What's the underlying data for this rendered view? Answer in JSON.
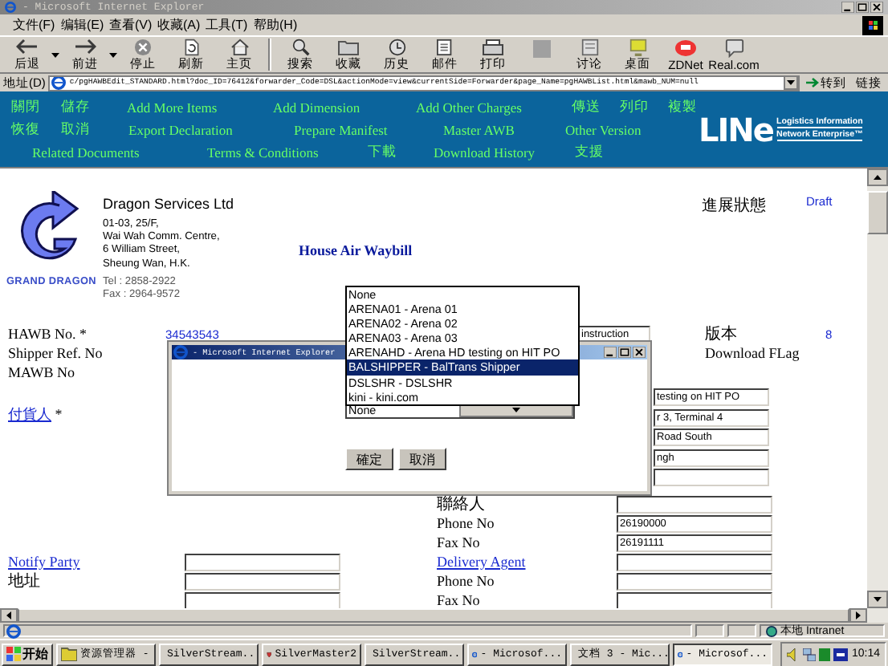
{
  "window": {
    "title": "- Microsoft Internet Explorer"
  },
  "menu": [
    "文件(F)",
    "编辑(E)",
    "查看(V)",
    "收藏(A)",
    "工具(T)",
    "帮助(H)"
  ],
  "toolbar": [
    {
      "kind": "back",
      "label": "后退",
      "disabled": false
    },
    {
      "kind": "forward",
      "label": "前进",
      "disabled": false
    },
    {
      "kind": "stop",
      "label": "停止",
      "disabled": false
    },
    {
      "kind": "refresh",
      "label": "刷新",
      "disabled": false
    },
    {
      "kind": "home",
      "label": "主页",
      "disabled": false
    },
    {
      "kind": "search",
      "label": "搜索",
      "disabled": false
    },
    {
      "kind": "favorites",
      "label": "收藏",
      "disabled": false
    },
    {
      "kind": "history",
      "label": "历史",
      "disabled": false
    },
    {
      "kind": "mail",
      "label": "邮件",
      "disabled": false
    },
    {
      "kind": "print",
      "label": "打印",
      "disabled": false
    },
    {
      "kind": "edit",
      "disabled": true
    },
    {
      "kind": "discuss",
      "label": "讨论",
      "disabled": false
    },
    {
      "kind": "desktop",
      "label": "桌面",
      "disabled": false
    },
    {
      "kind": "zdnet",
      "label": "ZDNet",
      "disabled": false
    },
    {
      "kind": "real",
      "label": "Real.com",
      "disabled": false
    }
  ],
  "address": {
    "label": "地址(D)",
    "url": "c/pgHAWBEdit_STANDARD.html?doc_ID=76412&forwarder_Code=DSL&actionMode=view&currentSide=Forwarder&page_Name=pgHAWBList.html&mawb_NUM=null",
    "go": "转到",
    "links": "链接"
  },
  "nav": {
    "lines": [
      {
        "links": [
          "關閉",
          "儲存",
          "Add More Items",
          "Add Dimension",
          "Add Other Charges",
          "傳送",
          "列印",
          "複製"
        ]
      },
      {
        "links": [
          "恢復",
          "取消",
          "Export Declaration",
          "Prepare Manifest",
          "Master AWB",
          "Other Version"
        ]
      },
      {
        "links": [
          "Related Documents",
          "Terms & Conditions",
          "下載",
          "Download History",
          "支援"
        ]
      }
    ],
    "brand": {
      "wordmark": "LINe",
      "line1": "Logistics Information",
      "line2": "Network Enterprise™"
    }
  },
  "company": {
    "logo_caption": "GRAND DRAGON",
    "name": "Dragon Services Ltd",
    "address": [
      "01-03, 25/F,",
      "Wai Wah Comm. Centre,",
      "6 William Street,",
      "Sheung Wan, H.K."
    ],
    "tel": "Tel : 2858-2922",
    "fax": "Fax : 2964-9572"
  },
  "doc_title": "House Air Waybill",
  "status": {
    "label": "進展狀態",
    "value": "Draft"
  },
  "version": {
    "label": "版本",
    "value": "8"
  },
  "download_flag": {
    "label": "Download FLag"
  },
  "form_top": [
    {
      "label": "HAWB No. *",
      "value": "34543543"
    },
    {
      "label": "Shipper Ref. No"
    },
    {
      "label": "MAWB No"
    }
  ],
  "instruction_field": {
    "value": "instruction"
  },
  "shipper": {
    "label": "付貨人",
    "mark": "*"
  },
  "covered_fields": [
    {
      "kind": "text",
      "value": "testing on HIT PO"
    },
    {
      "kind": "text",
      "value": "r 3, Terminal 4"
    },
    {
      "kind": "text",
      "value": "Road South"
    },
    {
      "kind": "text",
      "value": "ngh"
    },
    {
      "kind": "text"
    }
  ],
  "form_lower": [
    {
      "right": {
        "label": "聯絡人",
        "kind": "text",
        "field": {
          "kind": "text"
        }
      }
    },
    {
      "right": {
        "label": "Phone No",
        "kind": "text",
        "field": {
          "kind": "text",
          "value": "26190000"
        }
      }
    },
    {
      "right": {
        "label": "Fax No",
        "kind": "text",
        "field": {
          "kind": "text",
          "value": "26191111"
        }
      }
    },
    {
      "left": {
        "label": "Notify Party",
        "kind": "link",
        "field": {
          "kind": "text"
        }
      },
      "right": {
        "label": "Delivery Agent",
        "kind": "link",
        "field": {
          "kind": "text"
        }
      }
    },
    {
      "left": {
        "label": "地址",
        "kind": "text",
        "field": {
          "kind": "text"
        }
      },
      "right": {
        "label": "Phone No",
        "kind": "text",
        "field": {
          "kind": "text"
        }
      }
    },
    {
      "left": {
        "field": {
          "kind": "text"
        }
      },
      "right": {
        "label": "Fax No",
        "kind": "text",
        "field": {
          "kind": "text"
        }
      }
    }
  ],
  "dialog": {
    "title": "- Microsoft Internet Explorer",
    "expanded": true,
    "options": [
      {
        "label": "None",
        "selected": false
      },
      {
        "label": "ARENA01 - Arena 01",
        "selected": false
      },
      {
        "label": "ARENA02 - Arena 02",
        "selected": false
      },
      {
        "label": "ARENA03 - Arena 03",
        "selected": false
      },
      {
        "label": "ARENAHD - Arena HD testing on HIT PO",
        "selected": false
      },
      {
        "label": "BALSHIPPER - BalTrans Shipper",
        "selected": true
      },
      {
        "label": "DSLSHR - DSLSHR",
        "selected": false
      },
      {
        "label": "kini - kini.com",
        "selected": false
      }
    ],
    "select_value": "None",
    "buttons": [
      "確定",
      "取消"
    ]
  },
  "status_bar": {
    "zone": "本地 Intranet"
  },
  "taskbar": {
    "start": "开始",
    "clock": "10:14",
    "tasks": [
      {
        "kind": "explorer",
        "label": "资源管理器 -",
        "selected": false
      },
      {
        "kind": "silverstream",
        "label": "SilverStream...",
        "selected": false
      },
      {
        "kind": "silvermaster",
        "label": "SilverMaster2",
        "selected": false
      },
      {
        "kind": "silverstream",
        "label": "SilverStream...",
        "selected": false
      },
      {
        "kind": "ie",
        "label": "- Microsof...",
        "selected": false
      },
      {
        "kind": "word",
        "label": "文档 3 - Mic...",
        "selected": false
      },
      {
        "kind": "ie",
        "label": "- Microsof...",
        "selected": true
      }
    ]
  }
}
